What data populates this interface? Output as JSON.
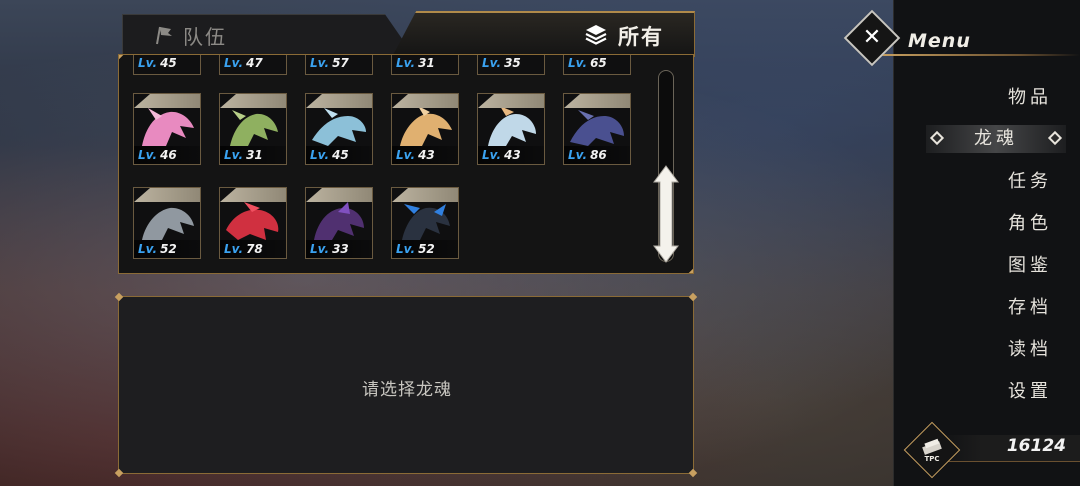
{
  "tabs": {
    "team": {
      "label": "队伍",
      "icon": "flag-icon"
    },
    "all": {
      "label": "所有",
      "icon": "stack-icon"
    }
  },
  "grid": {
    "partial_row": [
      {
        "lv": "Lv.",
        "level": "45"
      },
      {
        "lv": "Lv.",
        "level": "47"
      },
      {
        "lv": "Lv.",
        "level": "57"
      },
      {
        "lv": "Lv.",
        "level": "31"
      },
      {
        "lv": "Lv.",
        "level": "35"
      },
      {
        "lv": "Lv.",
        "level": "65"
      }
    ],
    "row1": [
      {
        "lv": "Lv.",
        "level": "46",
        "accent": "#e88ac0"
      },
      {
        "lv": "Lv.",
        "level": "31",
        "accent": "#8fb060"
      },
      {
        "lv": "Lv.",
        "level": "45",
        "accent": "#8cc0d8"
      },
      {
        "lv": "Lv.",
        "level": "43",
        "accent": "#e0b070"
      },
      {
        "lv": "Lv.",
        "level": "43",
        "accent": "#c0d8e8"
      },
      {
        "lv": "Lv.",
        "level": "86",
        "accent": "#6870b0"
      }
    ],
    "row2": [
      {
        "lv": "Lv.",
        "level": "52",
        "accent": "#9098a0"
      },
      {
        "lv": "Lv.",
        "level": "78",
        "accent": "#d03040"
      },
      {
        "lv": "Lv.",
        "level": "33",
        "accent": "#8050c0"
      },
      {
        "lv": "Lv.",
        "level": "52",
        "accent": "#3080e0"
      }
    ]
  },
  "detail": {
    "prompt": "请选择龙魂"
  },
  "menu": {
    "title": "Menu",
    "items": [
      "物品",
      "龙魂",
      "任务",
      "角色",
      "图鉴",
      "存档",
      "读档",
      "设置"
    ],
    "active": "龙魂"
  },
  "currency": {
    "value": "16124",
    "icon": "tpc-icon",
    "icon_text": "TPC"
  },
  "colors": {
    "accent_gold": "#c8a060",
    "level_blue": "#3aa2f0"
  }
}
